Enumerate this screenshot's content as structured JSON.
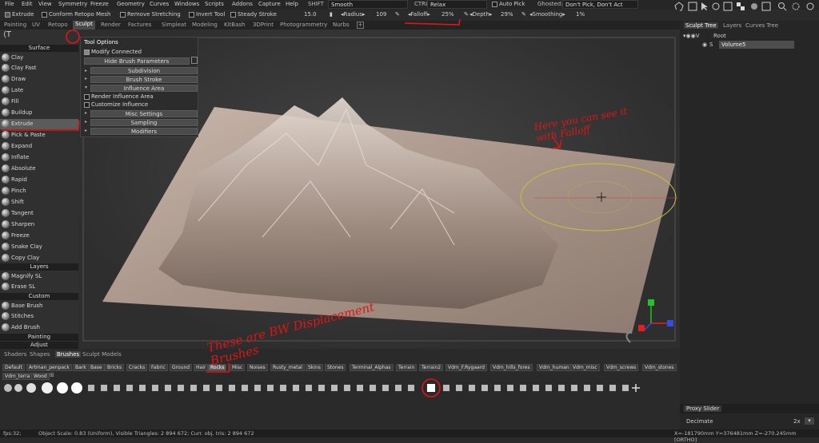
{
  "menu": [
    "File",
    "Edit",
    "View",
    "Symmetry",
    "Freeze",
    "Geometry",
    "Curves",
    "Windows",
    "Scripts",
    "Addons",
    "Capture",
    "Help"
  ],
  "toolbar": {
    "shift_label": "SHIFT",
    "shift_value": "Smooth",
    "ctrl_shift_label": "CTRL+SHIFT",
    "ctrl_shift_value": "Relax",
    "auto_pick": "Auto Pick",
    "ghosted_label": "Ghosted:",
    "ghosted_value": "Don't Pick, Don't Act",
    "extrude": "Extrude",
    "conform": "Conform Retopo Mesh",
    "remove_stretching": "Remove Stretching",
    "invert_tool": "Invert Tool",
    "steady_stroke": "Steady Stroke",
    "steady_value": "15.0",
    "radius_label": "Radius",
    "radius_value": "109",
    "falloff_label": "Falloff",
    "falloff_value": "25%",
    "depth_label": "Depth",
    "depth_value": "29%",
    "smoothing_label": "Smoothing",
    "smoothing_value": "1%"
  },
  "rooms": [
    "Painting",
    "UV",
    "Retopo",
    "Sculpt",
    "Render",
    "Factures",
    "Simpleat",
    "Modeling",
    "KitBash",
    "3DPrint",
    "Photogrammetry",
    "Nurbs"
  ],
  "active_room": "Sculpt",
  "left_panel": {
    "sections": {
      "surface": "Surface",
      "layers": "Layers",
      "custom": "Custom",
      "painting": "Painting",
      "adjust": "Adjust"
    },
    "surface_tools": [
      "Clay",
      "Clay Fast",
      "Draw",
      "Late",
      "Fill",
      "Buildup",
      "Extrude",
      "Pick & Paste",
      "Expand",
      "Inflate",
      "Absolute",
      "Rapid",
      "Pinch",
      "Shift",
      "Tangent",
      "Sharpen",
      "Freeze",
      "Snake Clay",
      "Copy Clay"
    ],
    "layer_tools": [
      "Magnify SL",
      "Erase SL"
    ],
    "custom_tools": [
      "Base Brush",
      "Stitches",
      "Add Brush"
    ],
    "selected": "Extrude"
  },
  "tool_options": {
    "title": "Tool Options",
    "modify_connected": "Modify Connected",
    "hide_params": "Hide Brush Parameters",
    "subdivision": "Subdivision",
    "brush_stroke": "Brush Stroke",
    "influence_area": "Influence Area",
    "render_influence": "Render Influence Area",
    "customize_influence": "Customize Influence",
    "misc_settings": "Misc Settings",
    "sampling": "Sampling",
    "modifiers": "Modifiers"
  },
  "right_panel": {
    "tabs": [
      "Sculpt Tree",
      "Layers",
      "Curves Tree"
    ],
    "root": "Root",
    "volume": "Volume5",
    "proxy_slider": "Proxy Slider",
    "decimate": "Decimate",
    "decimate_value": "2x"
  },
  "brush_panel": {
    "tabs": [
      "Shaders",
      "Shapes",
      "Brushes",
      "Sculpt Models"
    ],
    "active_tab": "Brushes",
    "categories_row1": [
      "Default",
      "Artman_penpack",
      "Bark",
      "Base",
      "Bricks",
      "Cracks",
      "Fabric",
      "Ground",
      "Hair",
      "Rocks",
      "Misc",
      "Noises",
      "Rusty_metal",
      "Skins",
      "Stones",
      "Terminal_Alphas",
      "Terrain",
      "Terrain2",
      "Vdm_F.Rygaard",
      "Vdm_hills_fores",
      "Vdm_human",
      "Vdm_misc",
      "Vdm_screws",
      "Vdm_stones"
    ],
    "categories_row2": [
      "Vdm_terra",
      "Wood"
    ],
    "selected_category": "Rocks"
  },
  "status": {
    "fps": "fps:32;",
    "info": "Object Scale: 0.83 (Uniform), Visible Triangles: 2 894 672; Curr. obj. tris: 2 894 672",
    "coords": "X=-181790mm  Y=376481mm  Z=-270.245mm [ORTHO]"
  },
  "annotations": {
    "right": "Here you can see it with Falloff",
    "bottom": "These are BW Displacement Brushes"
  },
  "colors": {
    "annotation": "#e01515",
    "axis_x": "#e32020",
    "axis_y": "#22c322",
    "axis_z": "#2f4fe6"
  }
}
